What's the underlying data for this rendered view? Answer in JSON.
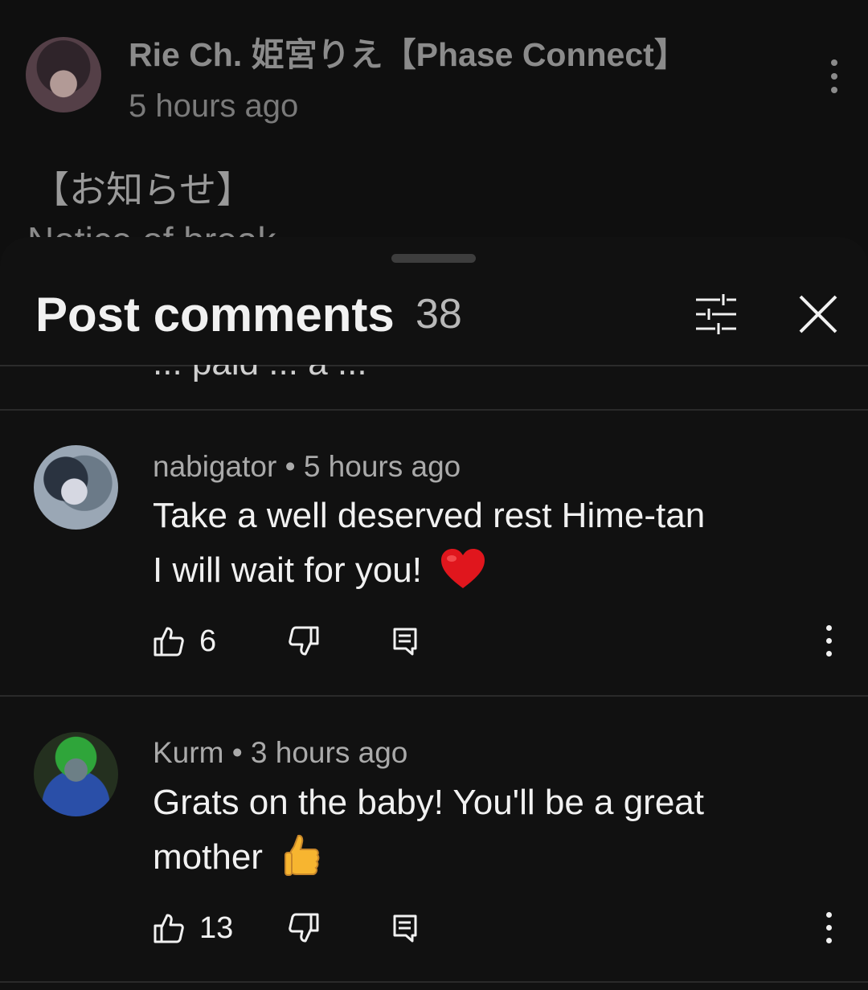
{
  "post": {
    "author": "Rie Ch. 姫宮りえ【Phase Connect】",
    "time": "5 hours ago",
    "text_line1": "【お知らせ】",
    "text_line2": "Notice of break"
  },
  "sheet": {
    "title": "Post comments",
    "count": "38",
    "partial_text": "... paid ... a ..."
  },
  "comments": [
    {
      "author": "nabigator",
      "time": "5 hours ago",
      "line1": "Take a well deserved rest Hime-tan",
      "line2": "I will wait for you!",
      "emoji": "red-heart",
      "likes": "6"
    },
    {
      "author": "Kurm",
      "time": "3 hours ago",
      "line1": "Grats on the baby! You'll be a great",
      "line2": "mother",
      "emoji": "thumbs-up",
      "likes": "13"
    }
  ],
  "colors": {
    "background": "#0f0f0f",
    "sheet": "#111111",
    "primary_text": "#f1f1f1",
    "secondary_text": "#aaaaaa"
  }
}
